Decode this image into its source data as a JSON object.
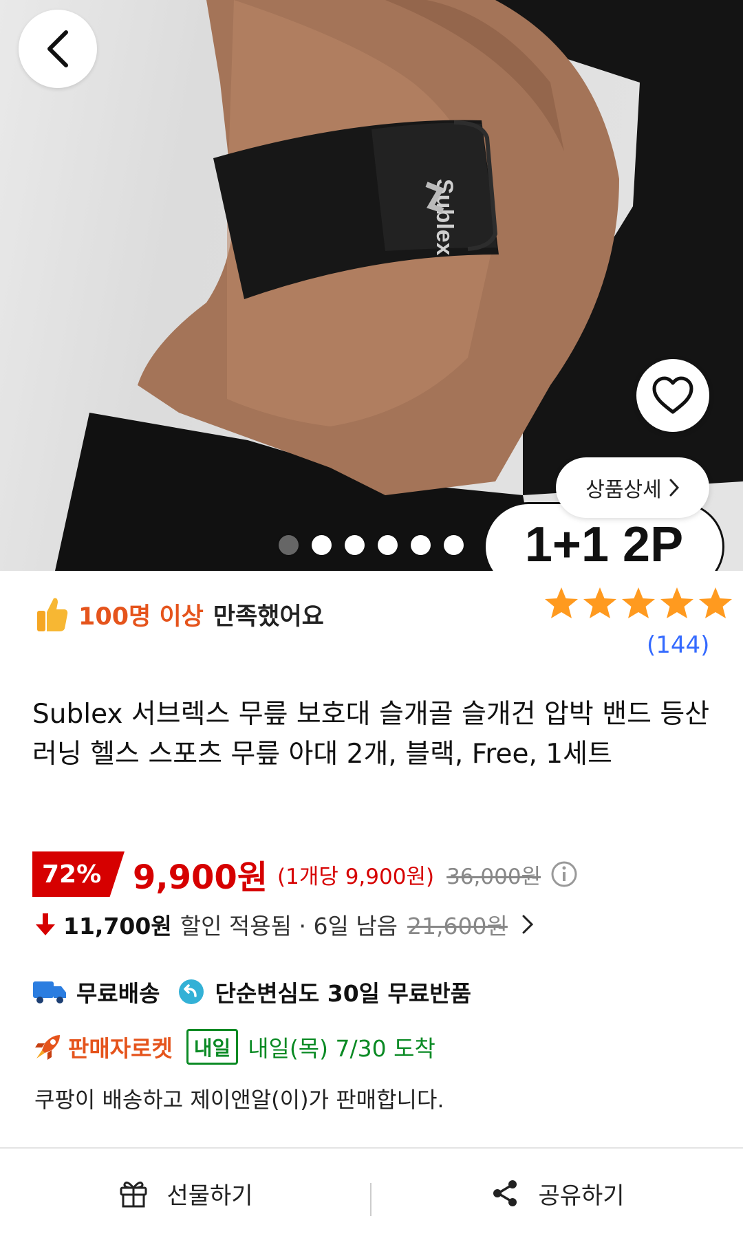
{
  "hero": {
    "brand_mark": "Sublex",
    "promo_badge": "1+1 2P",
    "detail_button_label": "상품상세",
    "carousel": {
      "total": 6,
      "active_index": 0
    }
  },
  "rating": {
    "satisfaction_highlight": "100명 이상",
    "satisfaction_suffix": "만족했어요",
    "stars": 5,
    "review_count": "(144)"
  },
  "product": {
    "title": "Sublex 서브렉스 무릎 보호대 슬개골 슬개건 압박 밴드 등산 러닝 헬스 스포츠 무릎 아대 2개, 블랙, Free, 1세트"
  },
  "price": {
    "discount": "72%",
    "sale_price": "9,900원",
    "unit_price": "(1개당 9,900원)",
    "original_price": "36,000원"
  },
  "coupon": {
    "amount": "11,700원",
    "text": "할인 적용됨 · 6일 남음",
    "prev_price": "21,600원"
  },
  "shipping": {
    "free_shipping": "무료배송",
    "free_return": "단순변심도 30일 무료반품",
    "rocket_label": "판매자로켓",
    "tomorrow_badge": "내일",
    "arrival": "내일(목) 7/30 도착",
    "seller_note": "쿠팡이 배송하고 제이앤알(이)가 판매합니다."
  },
  "bottom_bar": {
    "gift_label": "선물하기",
    "share_label": "공유하기"
  },
  "colors": {
    "accent_red": "#d60000",
    "orange": "#e5541c",
    "green": "#0a8a24",
    "link_blue": "#346aff",
    "star": "#ff9a1f"
  }
}
